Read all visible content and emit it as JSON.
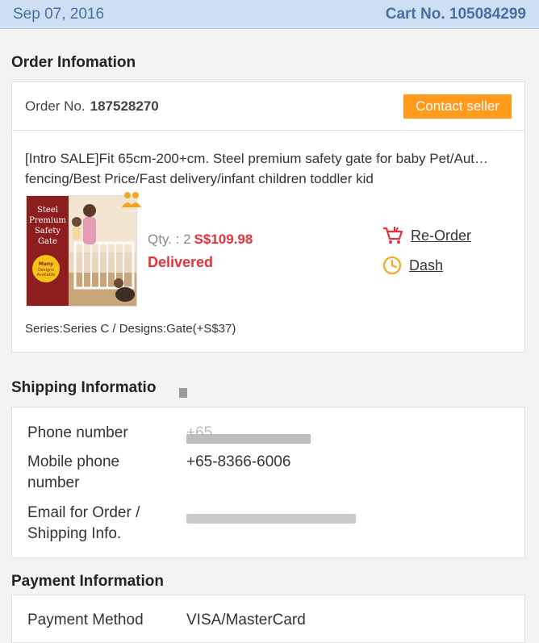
{
  "header": {
    "date": "Sep 07, 2016",
    "cart_label": "Cart No. 105084299"
  },
  "order_section": {
    "title": "Order Infomation",
    "order_label": "Order No.",
    "order_number": "187528270",
    "contact_button": "Contact seller",
    "product_title": "[Intro SALE]Fit 65cm-200+cm. Steel premium safety gate for baby Pet/Aut… fencing/Best Price/Fast delivery/infant children toddler kid",
    "thumb_text": [
      "Steel",
      "Premium",
      "Safety",
      "Gate"
    ],
    "thumb_badge": [
      "Many",
      "Designs",
      "Available"
    ],
    "qty": "Qty. : 2",
    "price": "S$109.98",
    "status": "Delivered",
    "reorder_label": "Re-Order",
    "dash_label": "Dash",
    "series": "Series:Series C / Designs:Gate(+S$37)",
    "accent_color": "#e5313a",
    "button_color": "#ff9a1c"
  },
  "shipping_section": {
    "title": "Shipping Informatio",
    "phone_label": "Phone number",
    "phone_value": "+65",
    "mobile_label_1": "Mobile phone",
    "mobile_label_2": "number",
    "mobile_value": "+65-8366-6006",
    "email_label_1": "Email for Order /",
    "email_label_2": "Shipping Info.",
    "email_value": "",
    "obscured_fields": [
      "phone-value",
      "email-value"
    ]
  },
  "payment_section": {
    "title": "Payment Information",
    "method_label": "Payment Method",
    "method_value": "VISA/MasterCard"
  }
}
